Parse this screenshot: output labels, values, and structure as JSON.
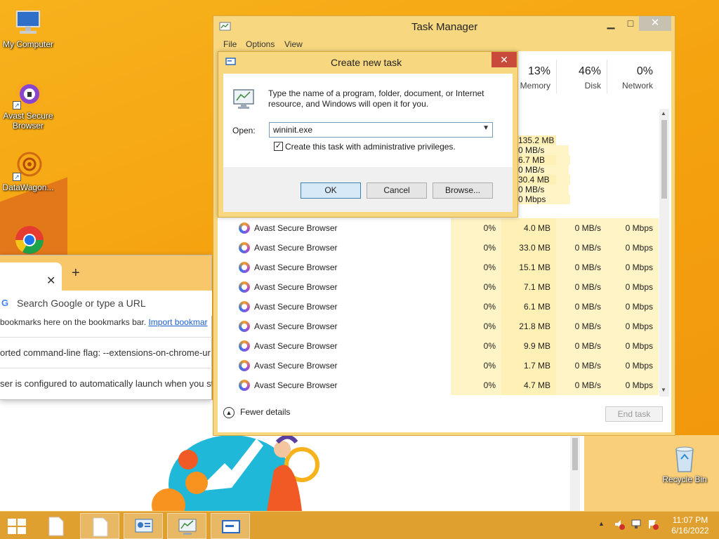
{
  "desktop": {
    "icons": [
      {
        "label": "My Computer"
      },
      {
        "label": "Avast Secure Browser"
      },
      {
        "label": "DataWagon..."
      },
      {
        "label": "Google Chrome"
      },
      {
        "label": "Recycle Bin"
      }
    ]
  },
  "browser": {
    "search_placeholder": "Search Google or type a URL",
    "bookmarks_text": "bookmarks here on the bookmarks bar.",
    "import_link": "Import bookmar",
    "info1": "orted command-line flag: --extensions-on-chrome-ur",
    "info2": "ser is configured to automatically launch when you st"
  },
  "task_manager": {
    "title": "Task Manager",
    "menu": [
      "File",
      "Options",
      "View"
    ],
    "columns": [
      {
        "pct": "13%",
        "label": "Memory"
      },
      {
        "pct": "46%",
        "label": "Disk"
      },
      {
        "pct": "0%",
        "label": "Network"
      }
    ],
    "upper_rows": [
      {
        "mem": "135.2 MB",
        "disk": "0 MB/s",
        "net": "0 Mbps"
      },
      {
        "mem": "6.7 MB",
        "disk": "0 MB/s",
        "net": "0 Mbps"
      },
      {
        "mem": "30.4 MB",
        "disk": "0 MB/s",
        "net": "0 Mbps"
      }
    ],
    "rows": [
      {
        "name": "Avast Secure Browser",
        "cpu": "0%",
        "mem": "4.0 MB",
        "disk": "0 MB/s",
        "net": "0 Mbps"
      },
      {
        "name": "Avast Secure Browser",
        "cpu": "0%",
        "mem": "33.0 MB",
        "disk": "0 MB/s",
        "net": "0 Mbps"
      },
      {
        "name": "Avast Secure Browser",
        "cpu": "0%",
        "mem": "15.1 MB",
        "disk": "0 MB/s",
        "net": "0 Mbps"
      },
      {
        "name": "Avast Secure Browser",
        "cpu": "0%",
        "mem": "7.1 MB",
        "disk": "0 MB/s",
        "net": "0 Mbps"
      },
      {
        "name": "Avast Secure Browser",
        "cpu": "0%",
        "mem": "6.1 MB",
        "disk": "0 MB/s",
        "net": "0 Mbps"
      },
      {
        "name": "Avast Secure Browser",
        "cpu": "0%",
        "mem": "21.8 MB",
        "disk": "0 MB/s",
        "net": "0 Mbps"
      },
      {
        "name": "Avast Secure Browser",
        "cpu": "0%",
        "mem": "9.9 MB",
        "disk": "0 MB/s",
        "net": "0 Mbps"
      },
      {
        "name": "Avast Secure Browser",
        "cpu": "0%",
        "mem": "1.7 MB",
        "disk": "0 MB/s",
        "net": "0 Mbps"
      },
      {
        "name": "Avast Secure Browser",
        "cpu": "0%",
        "mem": "4.7 MB",
        "disk": "0 MB/s",
        "net": "0 Mbps"
      }
    ],
    "fewer_details": "Fewer details",
    "end_task": "End task"
  },
  "dialog": {
    "title": "Create new task",
    "description": "Type the name of a program, folder, document, or Internet resource, and Windows will open it for you.",
    "open_label": "Open:",
    "open_value": "wininit.exe",
    "admin_label": "Create this task with administrative privileges.",
    "admin_checked": true,
    "ok": "OK",
    "cancel": "Cancel",
    "browse": "Browse..."
  },
  "taskbar": {
    "time": "11:07 PM",
    "date": "6/16/2022"
  }
}
